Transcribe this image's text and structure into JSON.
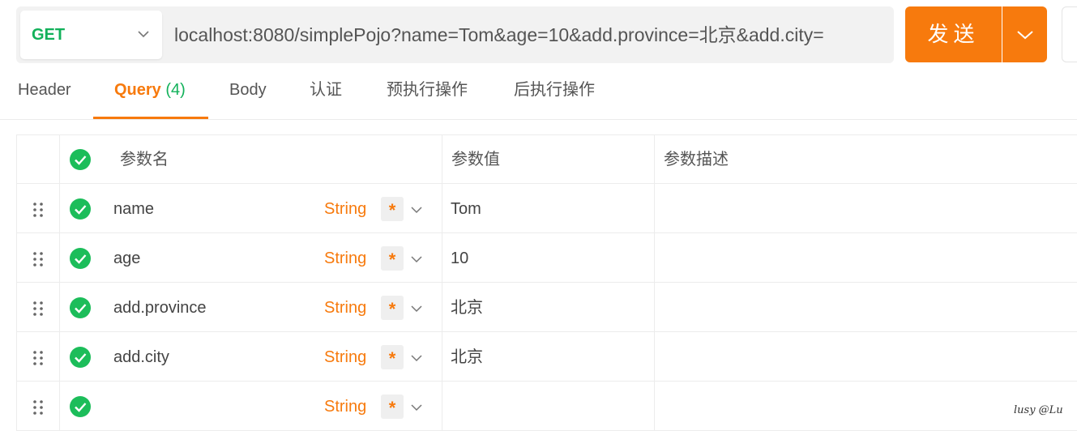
{
  "request": {
    "method": "GET",
    "url": "localhost:8080/simplePojo?name=Tom&age=10&add.province=北京&add.city=",
    "send_label": "发送"
  },
  "tabs": [
    {
      "label": "Header"
    },
    {
      "label": "Query",
      "count": "(4)",
      "active": true
    },
    {
      "label": "Body"
    },
    {
      "label": "认证"
    },
    {
      "label": "预执行操作"
    },
    {
      "label": "后执行操作"
    }
  ],
  "table": {
    "headers": {
      "name": "参数名",
      "value": "参数值",
      "description": "参数描述"
    },
    "rows": [
      {
        "name": "name",
        "type": "String",
        "required": "*",
        "value": "Tom",
        "description": ""
      },
      {
        "name": "age",
        "type": "String",
        "required": "*",
        "value": "10",
        "description": ""
      },
      {
        "name": "add.province",
        "type": "String",
        "required": "*",
        "value": "北京",
        "description": ""
      },
      {
        "name": "add.city",
        "type": "String",
        "required": "*",
        "value": "北京",
        "description": ""
      },
      {
        "name": "",
        "type": "String",
        "required": "*",
        "value": "",
        "description": ""
      }
    ]
  },
  "watermark": "lusy @Lu",
  "colors": {
    "accent": "#f77a0d",
    "method": "#12b15a",
    "check": "#1cbd5a"
  }
}
